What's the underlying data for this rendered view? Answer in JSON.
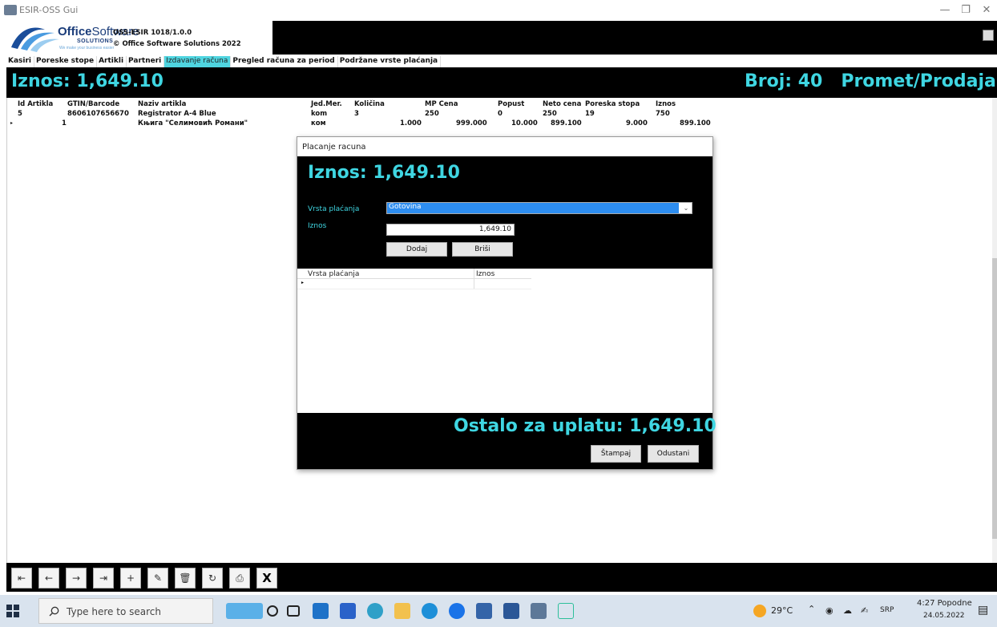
{
  "window": {
    "title": "ESIR-OSS Gui",
    "minimize": "—",
    "maximize": "❐",
    "close": "✕"
  },
  "header": {
    "brand_bold": "Office",
    "brand_thin": "Software",
    "solutions": "SOLUTIONS",
    "tagline": "We make your business easier",
    "version": "OSS-ESIR 1018/1.0.0",
    "copyright": "© Office Software Solutions 2022"
  },
  "menu": [
    {
      "label": "Kasiri",
      "active": false
    },
    {
      "label": "Poreske stope",
      "active": false
    },
    {
      "label": "Artikli",
      "active": false
    },
    {
      "label": "Partneri",
      "active": false
    },
    {
      "label": "Izdavanje računa",
      "active": true
    },
    {
      "label": "Pregled računa za period",
      "active": false
    },
    {
      "label": "Podržane vrste plaćanja",
      "active": false
    }
  ],
  "totals": {
    "iznos": "Iznos: 1,649.10",
    "broj": "Broj: 40   Promet/Prodaja"
  },
  "grid": {
    "columns": [
      "Id Artikla",
      "GTIN/Barcode",
      "Naziv artikla",
      "Jed.Mer.",
      "Količina",
      "MP Cena",
      "Popust",
      "Neto cena",
      "Poreska stopa",
      "Iznos"
    ],
    "rows": [
      [
        "5",
        "8606107656670",
        "Registrator A-4 Blue",
        "kom",
        "3",
        "250",
        "0",
        "250",
        "19",
        "750"
      ],
      [
        "1",
        "",
        "Књига \"Селимовић Романи\"",
        "ком",
        "1.000",
        "999.000",
        "10.000",
        "899.100",
        "9.000",
        "899.100"
      ]
    ],
    "current_marker": "▸"
  },
  "dialog": {
    "title": "Placanje racuna",
    "amount": "Iznos: 1,649.10",
    "payment_type_label": "Vrsta plaćanja",
    "payment_type_value": "Gotovina",
    "amount_label": "Iznos",
    "amount_value": "1,649.10",
    "add_label": "Dodaj",
    "delete_label": "Briši",
    "table_col_type": "Vrsta plaćanja",
    "table_col_amount": "Iznos",
    "remaining": "Ostalo za uplatu: 1,649.10",
    "print_label": "Štampaj",
    "cancel_label": "Odustani"
  },
  "toolbar": {
    "first": "⇤",
    "prev": "←",
    "next": "→",
    "last": "⇥",
    "add": "+",
    "edit": "✎",
    "delete": "🗑",
    "refresh": "↻",
    "print": "⎙",
    "close": "X"
  },
  "taskbar": {
    "search_placeholder": "Type here to search",
    "weather": "29°C",
    "language": "SRP",
    "time": "4:27 Popodne",
    "date": "24.05.2022"
  },
  "colors": {
    "accent": "#3fd6e2",
    "active_tab": "#4fd5e0",
    "select_highlight": "#2d8df0"
  }
}
